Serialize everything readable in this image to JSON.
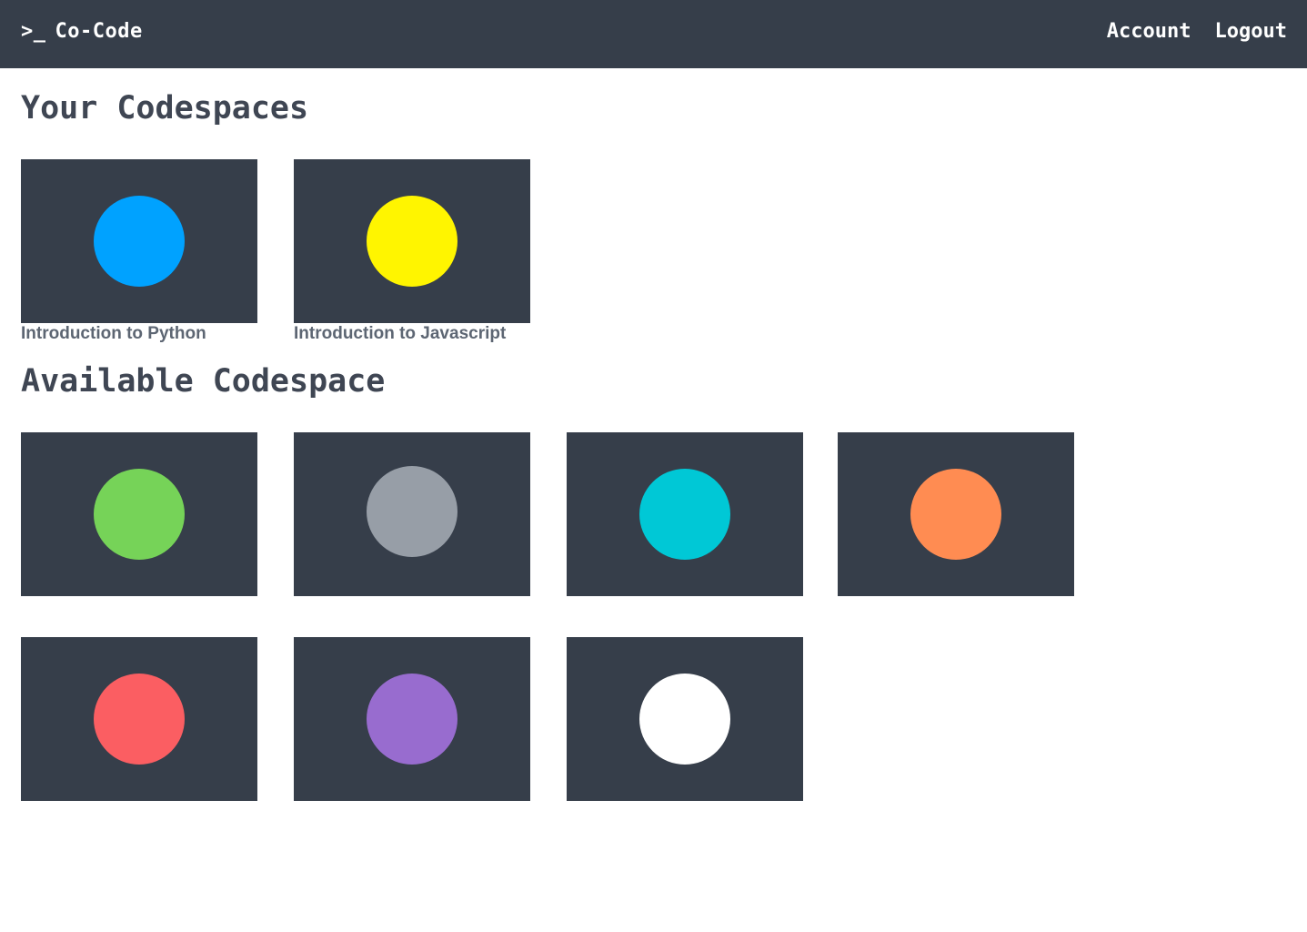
{
  "navbar": {
    "prompt": ">_",
    "brand": "Co-Code",
    "links": [
      "Account",
      "Logout"
    ]
  },
  "sections": {
    "your_title": "Your Codespaces",
    "available_title": "Available Codespace"
  },
  "your_codespaces": [
    {
      "label": "Introduction to Python",
      "color": "#00a2ff"
    },
    {
      "label": "Introduction to Javascript",
      "color": "#fff500"
    }
  ],
  "available_codespaces": [
    {
      "color": "#76d358"
    },
    {
      "color": "#979ea7"
    },
    {
      "color": "#00c8d6"
    },
    {
      "color": "#ff8c52"
    },
    {
      "color": "#fb5e62"
    },
    {
      "color": "#986ccf"
    },
    {
      "color": "#ffffff"
    }
  ],
  "colors": {
    "navbar_bg": "#363e4a",
    "card_bg": "#363e4a",
    "heading": "#3f4653",
    "label": "#5d6673"
  }
}
